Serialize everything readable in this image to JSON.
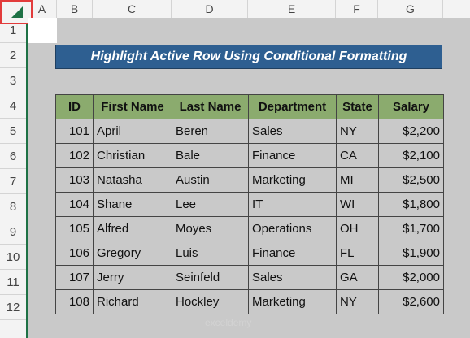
{
  "columns": [
    "A",
    "B",
    "C",
    "D",
    "E",
    "F",
    "G"
  ],
  "rows": [
    "1",
    "2",
    "3",
    "4",
    "5",
    "6",
    "7",
    "8",
    "9",
    "10",
    "11",
    "12"
  ],
  "title": "Highlight Active Row Using Conditional Formatting",
  "table": {
    "headers": [
      "ID",
      "First Name",
      "Last Name",
      "Department",
      "State",
      "Salary"
    ],
    "rows": [
      [
        "101",
        "April",
        "Beren",
        "Sales",
        "NY",
        "$2,200"
      ],
      [
        "102",
        "Christian",
        "Bale",
        "Finance",
        "CA",
        "$2,100"
      ],
      [
        "103",
        "Natasha",
        "Austin",
        "Marketing",
        "MI",
        "$2,500"
      ],
      [
        "104",
        "Shane",
        "Lee",
        "IT",
        "WI",
        "$1,800"
      ],
      [
        "105",
        "Alfred",
        "Moyes",
        "Operations",
        "OH",
        "$1,700"
      ],
      [
        "106",
        "Gregory",
        "Luis",
        "Finance",
        "FL",
        "$1,900"
      ],
      [
        "107",
        "Jerry",
        "Seinfeld",
        "Sales",
        "GA",
        "$2,000"
      ],
      [
        "108",
        "Richard",
        "Hockley",
        "Marketing",
        "NY",
        "$2,600"
      ]
    ]
  },
  "watermark": "exceldemy",
  "colors": {
    "title_bg": "#2e5f91",
    "header_bg": "#8bab6e",
    "sheet_bg": "#c9c9c9",
    "select_all_border": "#e23b3b"
  }
}
